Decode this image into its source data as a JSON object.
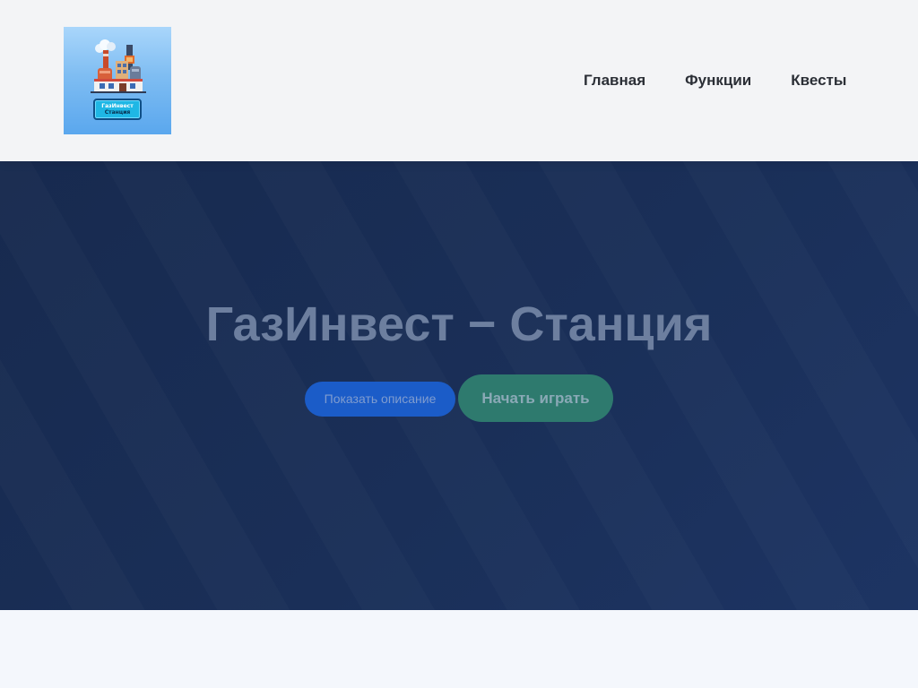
{
  "header": {
    "logo": {
      "line1": "ГазИнвест",
      "line2": "Станция",
      "icon": "gas-station-factory-logo"
    },
    "nav": [
      {
        "label": "Главная"
      },
      {
        "label": "Функции"
      },
      {
        "label": "Квесты"
      }
    ]
  },
  "hero": {
    "title": "ГазИнвест − Станция",
    "show_description_label": "Показать описание",
    "start_game_label": "Начать играть"
  },
  "colors": {
    "header_bg": "#f3f4f6",
    "hero_bg": "#1a2f58",
    "hero_title": "#6d7f9f",
    "button_desc_bg": "#1b5cc8",
    "button_play_bg": "#2e7a6e",
    "nav_text": "#2b2f36"
  }
}
